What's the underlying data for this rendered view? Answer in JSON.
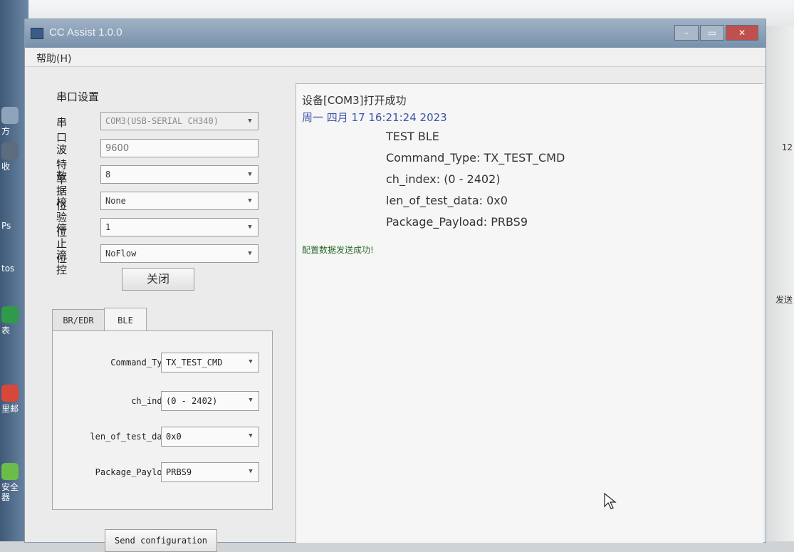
{
  "window": {
    "title": "CC Assist 1.0.0",
    "buttons": {
      "minimize": "–",
      "maximize": "▭",
      "close": "✕"
    }
  },
  "menu": {
    "help": "帮助(H)"
  },
  "serial": {
    "group_title": "串口设置",
    "port_label": "串 口",
    "port_value": "COM3(USB-SERIAL CH340)",
    "baud_label": "波特率",
    "baud_value": "9600",
    "databits_label": "数据位",
    "databits_value": "8",
    "parity_label": "校验位",
    "parity_value": "None",
    "stopbits_label": "停止位",
    "stopbits_value": "1",
    "flow_label": "流 控",
    "flow_value": "NoFlow",
    "close_button": "关闭"
  },
  "tabs": {
    "br_edr": "BR/EDR",
    "ble": "BLE"
  },
  "ble": {
    "command_type_label": "Command_Type",
    "command_type_value": "TX_TEST_CMD",
    "ch_index_label": "ch_index",
    "ch_index_value": "(0 - 2402)",
    "len_label": "len_of_test_data",
    "len_value": "0x0",
    "payload_label": "Package_Payload",
    "payload_value": "PRBS9",
    "send_button": "Send configuration"
  },
  "log": {
    "status": "设备[COM3]打开成功",
    "timestamp": "周一 四月 17 16:21:24 2023",
    "lines": [
      "TEST BLE",
      "Command_Type: TX_TEST_CMD",
      "ch_index: (0 - 2402)",
      "len_of_test_data: 0x0",
      "Package_Payload: PRBS9"
    ],
    "success": "配置数据发送成功!"
  },
  "desktop": {
    "left_labels": [
      "方",
      "收",
      "Ps",
      "tos",
      "表",
      "里邮",
      "安全器"
    ],
    "right_labels": [
      "12",
      "发送"
    ]
  },
  "colors": {
    "timestamp": "#3b55a8",
    "success": "#2c6b2c",
    "titlebar": "#7891ab"
  }
}
